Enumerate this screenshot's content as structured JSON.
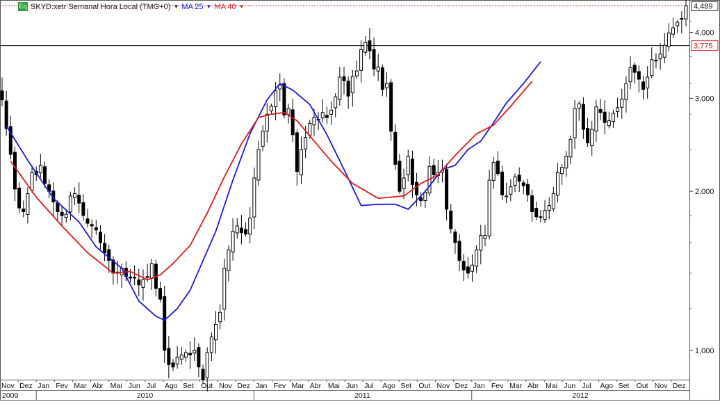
{
  "legend": {
    "badge": "Eq",
    "symbol": "SKYD:xetr Semanal Hora Local (TMG+0)",
    "ma25": "MA 25",
    "ma40": "MA 40"
  },
  "colors": {
    "price": "#000000",
    "ma25": "#1a1adf",
    "ma40": "#e01919",
    "high_line": "#cc2222",
    "last_line": "#000000",
    "badge": "#2e9e3e"
  },
  "chart_data": {
    "type": "candlestick",
    "scale": "log",
    "ylim": [
      880,
      4550
    ],
    "yticks": [
      {
        "v": 1000,
        "label": "1,000"
      },
      {
        "v": 2000,
        "label": "2,000"
      },
      {
        "v": 3000,
        "label": "3,000"
      },
      {
        "v": 4000,
        "label": "4,000"
      }
    ],
    "last_price": {
      "v": 4489,
      "label": "4,489"
    },
    "ref_line": {
      "v": 3775,
      "label": "3,775"
    },
    "months": [
      "Nov",
      "Dez",
      "Jan",
      "Fev",
      "Mar",
      "Abr",
      "Mai",
      "Jun",
      "Jul",
      "Ago",
      "Set",
      "Out",
      "Nov",
      "Dez",
      "Jan",
      "Fev",
      "Mar",
      "Abr",
      "Mai",
      "Jun",
      "Jul",
      "Ago",
      "Set",
      "Out",
      "Nov",
      "Dez",
      "Jan",
      "Fev",
      "Mar",
      "Abr",
      "Mai",
      "Jun",
      "Jul",
      "Ago",
      "Set",
      "Out",
      "Nov",
      "Dez"
    ],
    "years": [
      {
        "label": "2009",
        "start": 0,
        "span": 2
      },
      {
        "label": "2010",
        "start": 2,
        "span": 12
      },
      {
        "label": "2011",
        "start": 14,
        "span": 12
      },
      {
        "label": "2012",
        "start": 26,
        "span": 12
      }
    ],
    "weekly_close": [
      2980,
      2630,
      2350,
      2020,
      1860,
      1830,
      1980,
      2170,
      2150,
      2240,
      2070,
      2000,
      1910,
      1830,
      1800,
      1810,
      1960,
      1980,
      1900,
      1800,
      1740,
      1720,
      1690,
      1600,
      1530,
      1480,
      1400,
      1400,
      1430,
      1380,
      1370,
      1370,
      1330,
      1360,
      1380,
      1460,
      1310,
      1250,
      1000,
      940,
      930,
      970,
      980,
      990,
      980,
      1000,
      930,
      880,
      990,
      1060,
      1120,
      1180,
      1430,
      1550,
      1680,
      1720,
      1670,
      1660,
      1780,
      2120,
      2400,
      2600,
      2800,
      2900,
      3100,
      3180,
      2790,
      2870,
      2560,
      2180,
      2400,
      2530,
      2690,
      2760,
      2730,
      2820,
      2760,
      2850,
      3020,
      3290,
      3240,
      3030,
      3300,
      3380,
      3710,
      3830,
      3690,
      3410,
      3440,
      3120,
      3200,
      2600,
      2250,
      2000,
      2120,
      2330,
      2060,
      1970,
      1920,
      1990,
      2230,
      2150,
      2170,
      2190,
      1850,
      1700,
      1600,
      1480,
      1420,
      1400,
      1450,
      1550,
      1650,
      1650,
      2100,
      2270,
      2160,
      1970,
      1960,
      2040,
      2130,
      2090,
      2050,
      1970,
      1830,
      1790,
      1790,
      1840,
      1880,
      1980,
      2170,
      2220,
      2330,
      2510,
      2870,
      2930,
      2620,
      2470,
      2620,
      2890,
      2820,
      2700,
      2720,
      2810,
      2880,
      2990,
      3200,
      3430,
      3360,
      3260,
      3120,
      3290,
      3550,
      3530,
      3640,
      3780,
      3990,
      4080,
      4180,
      4250,
      4489
    ],
    "ma25": [
      [
        1,
        2660
      ],
      [
        6,
        2290
      ],
      [
        12,
        1940
      ],
      [
        18,
        1750
      ],
      [
        22,
        1570
      ],
      [
        28,
        1430
      ],
      [
        32,
        1240
      ],
      [
        36,
        1160
      ],
      [
        38,
        1140
      ],
      [
        41,
        1200
      ],
      [
        44,
        1300
      ],
      [
        50,
        1680
      ],
      [
        54,
        2100
      ],
      [
        58,
        2570
      ],
      [
        62,
        2980
      ],
      [
        65,
        3200
      ],
      [
        68,
        3110
      ],
      [
        72,
        2920
      ],
      [
        76,
        2560
      ],
      [
        80,
        2200
      ],
      [
        84,
        1880
      ],
      [
        88,
        1890
      ],
      [
        92,
        1890
      ],
      [
        95,
        1850
      ],
      [
        99,
        2000
      ],
      [
        103,
        2200
      ],
      [
        106,
        2240
      ],
      [
        109,
        2400
      ],
      [
        112,
        2490
      ],
      [
        115,
        2700
      ],
      [
        118,
        2940
      ],
      [
        122,
        3200
      ],
      [
        126,
        3520
      ]
    ],
    "ma40": [
      [
        2,
        2280
      ],
      [
        8,
        1950
      ],
      [
        14,
        1720
      ],
      [
        20,
        1530
      ],
      [
        26,
        1400
      ],
      [
        30,
        1410
      ],
      [
        34,
        1360
      ],
      [
        37,
        1390
      ],
      [
        40,
        1460
      ],
      [
        44,
        1580
      ],
      [
        48,
        1820
      ],
      [
        52,
        2130
      ],
      [
        56,
        2460
      ],
      [
        60,
        2760
      ],
      [
        63,
        2800
      ],
      [
        66,
        2820
      ],
      [
        69,
        2720
      ],
      [
        73,
        2490
      ],
      [
        77,
        2280
      ],
      [
        82,
        2070
      ],
      [
        88,
        1940
      ],
      [
        94,
        1960
      ],
      [
        98,
        2070
      ],
      [
        102,
        2150
      ],
      [
        106,
        2340
      ],
      [
        111,
        2570
      ],
      [
        115,
        2670
      ],
      [
        119,
        2900
      ],
      [
        124,
        3230
      ]
    ]
  }
}
